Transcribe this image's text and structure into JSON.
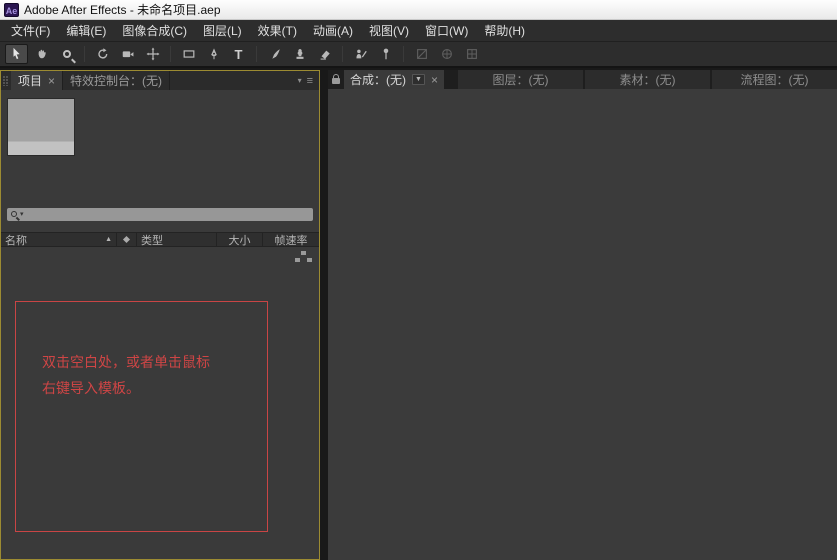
{
  "titlebar": {
    "app_icon_label": "Ae",
    "title": "Adobe After Effects - 未命名项目.aep"
  },
  "menubar": {
    "items": [
      "文件(F)",
      "编辑(E)",
      "图像合成(C)",
      "图层(L)",
      "效果(T)",
      "动画(A)",
      "视图(V)",
      "窗口(W)",
      "帮助(H)"
    ]
  },
  "toolbar": {
    "type_tool_label": "T"
  },
  "left_panel": {
    "tabs": {
      "project_label": "项目",
      "project_close": "×",
      "effect_controls_label": "特效控制台：(无)"
    },
    "project": {
      "columns": {
        "name": "名称",
        "type": "类型",
        "size": "大小",
        "framerate": "帧速率"
      },
      "sort_glyph": "▲",
      "empty_hint": "双击空白处，或者单击鼠标\n右键导入模板。"
    }
  },
  "right_panel": {
    "composition_tab": "合成：(无)",
    "composition_dropdown": "▼",
    "composition_close": "×",
    "layer_tab": "图层：(无)",
    "footage_tab": "素材：(无)",
    "flowchart_tab": "流程图：(无)"
  },
  "icons": {
    "panel_menu": "≡",
    "caret_down": "▾"
  },
  "colors": {
    "active_panel_border": "#9c8b32",
    "hint_red": "#cf4545",
    "panel_bg": "#3a3a3a"
  }
}
